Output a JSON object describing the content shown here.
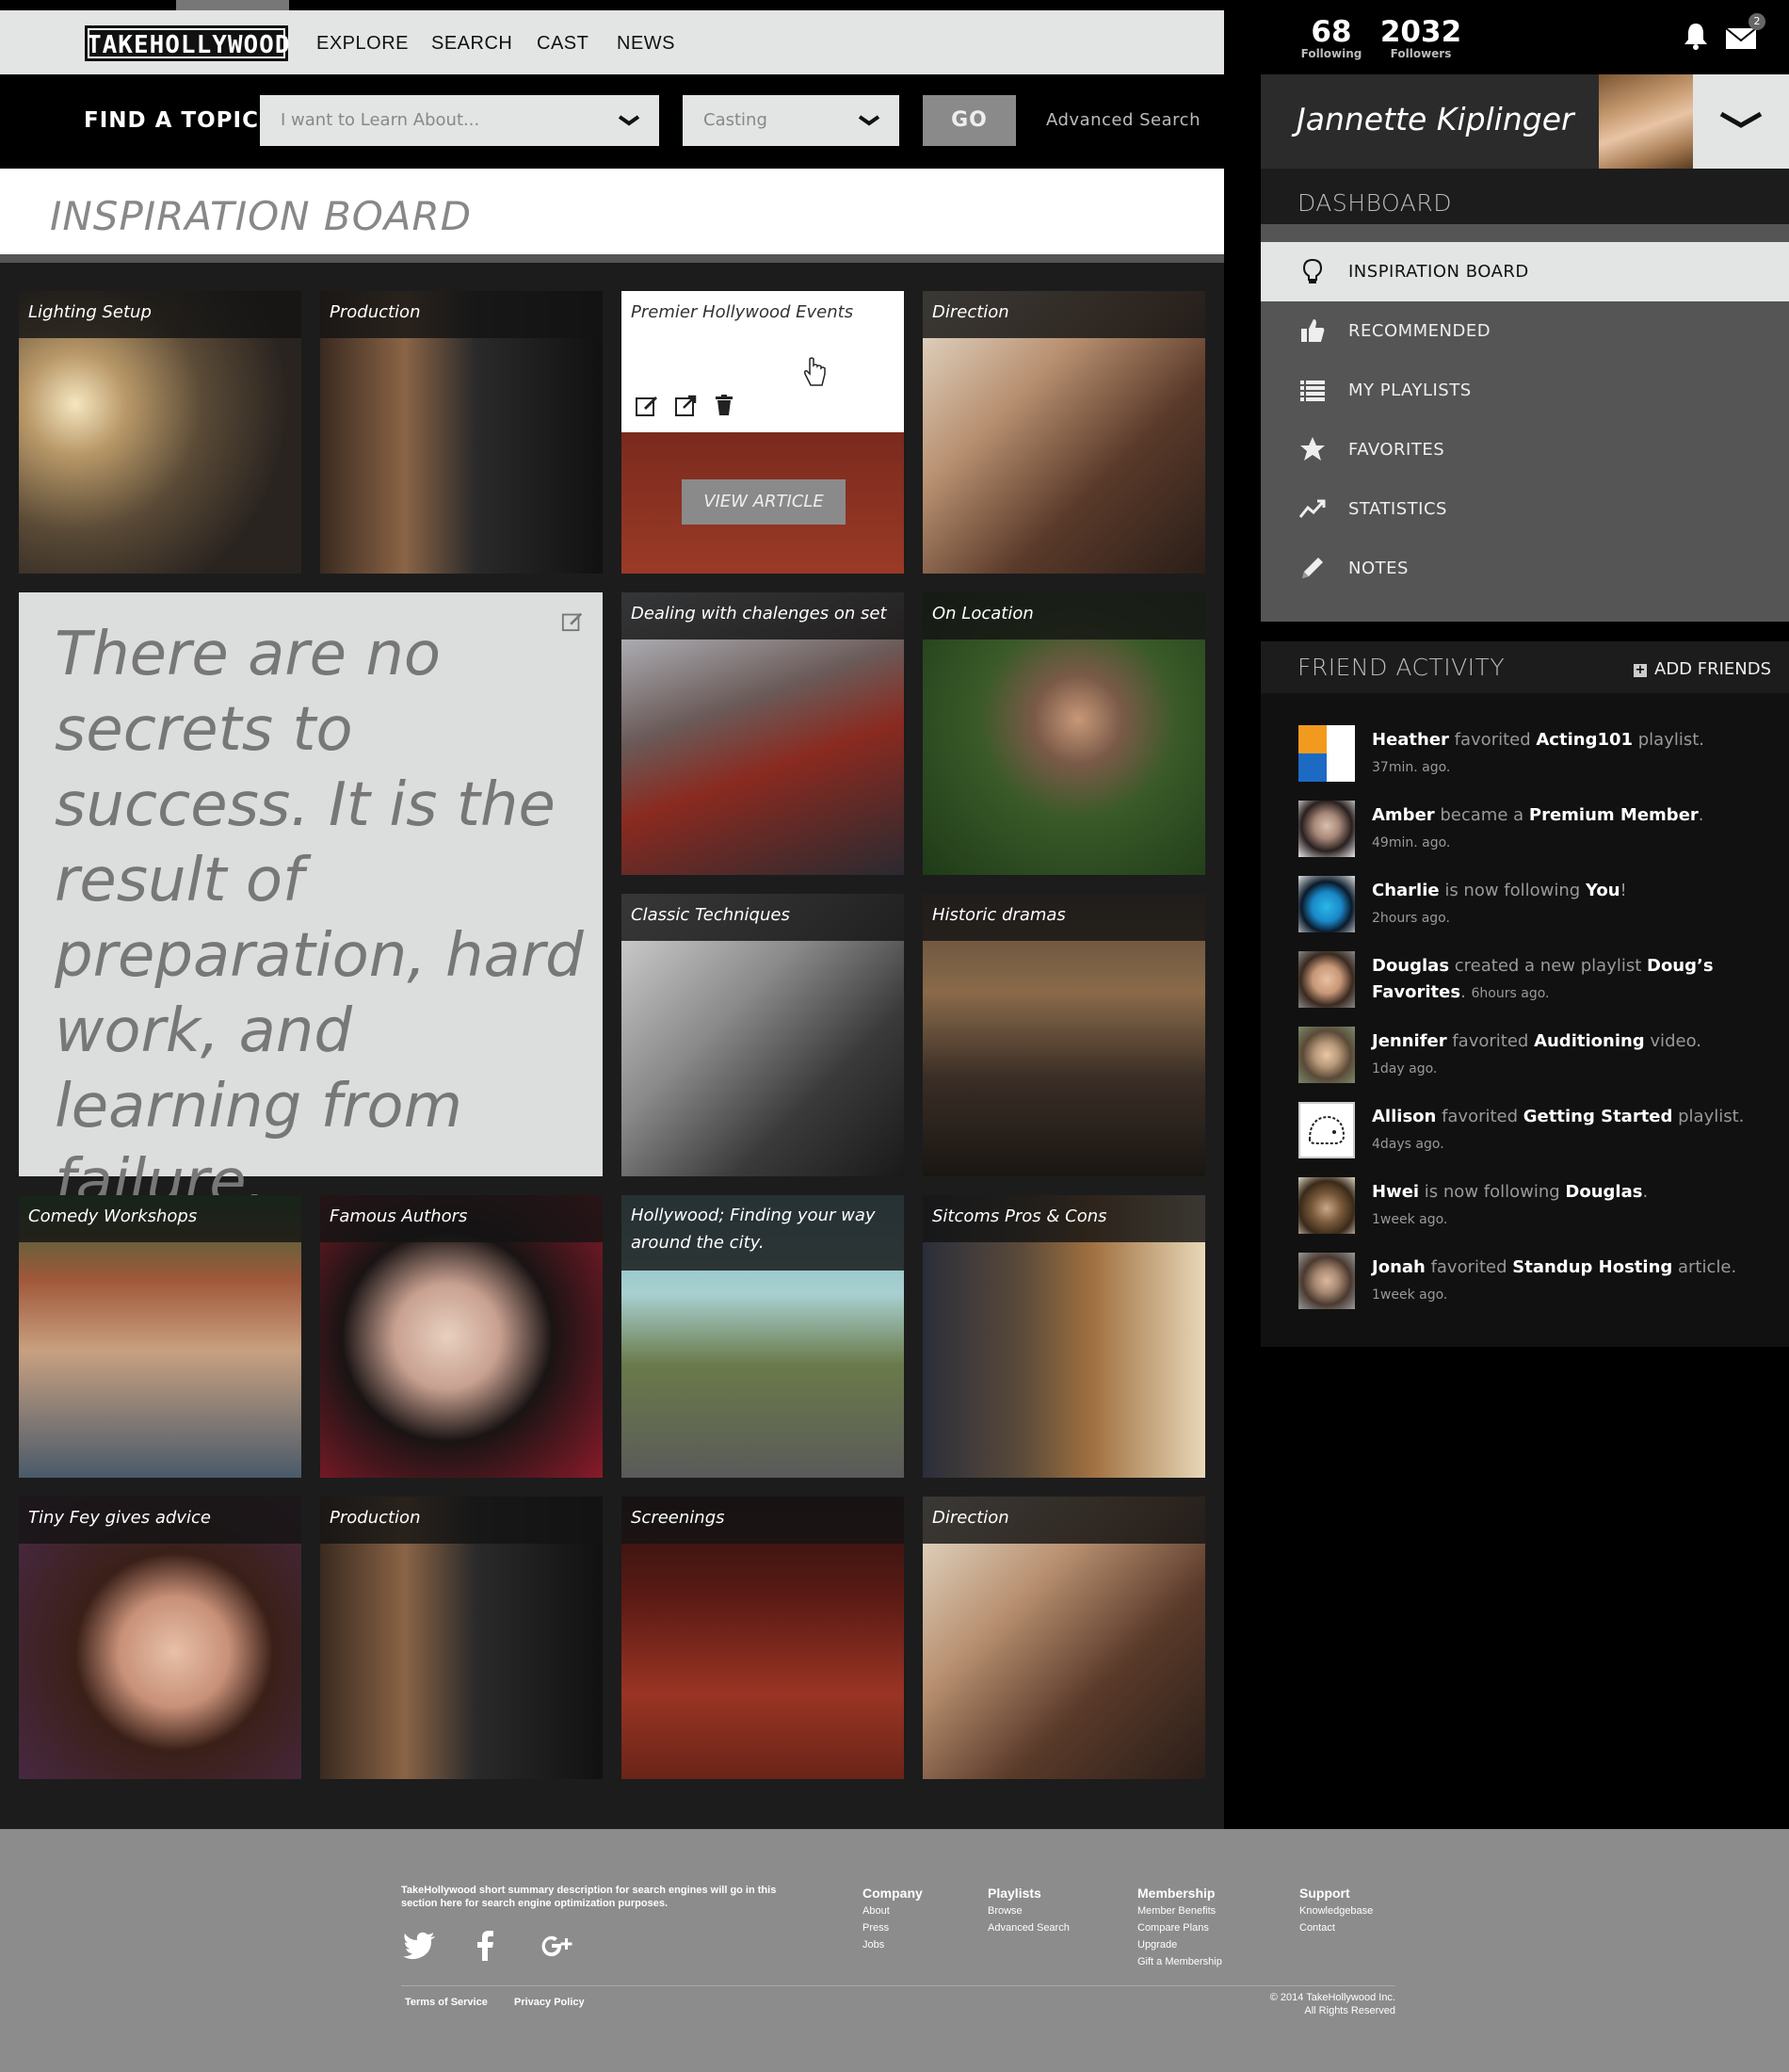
{
  "nav": {
    "logo": "TAKEHOLLYWOOD",
    "links": [
      "EXPLORE",
      "SEARCH",
      "CAST",
      "NEWS"
    ]
  },
  "find": {
    "label": "FIND A TOPIC",
    "topic_placeholder": "I want to Learn About...",
    "category_value": "Casting",
    "go": "GO",
    "advanced": "Advanced Search"
  },
  "page": {
    "title": "INSPIRATION BOARD"
  },
  "board": {
    "tiles": [
      "Lighting Setup",
      "Production",
      "Premier Hollywood Events",
      "Direction",
      "Dealing with chalenges on set",
      "On Location",
      "Classic Techniques",
      "Historic dramas",
      "Comedy Workshops",
      "Famous Authors",
      "Hollywood; Finding your way around the city.",
      "Sitcoms Pros & Cons",
      "Tiny Fey gives advice",
      "Production",
      "Screenings",
      "Direction"
    ],
    "view_article": "VIEW ARTICLE",
    "quote": "There are no secrets to success. It is the result of preparation, hard work, and learning from failure."
  },
  "user": {
    "following_count": "68",
    "following_label": "Following",
    "followers_count": "2032",
    "followers_label": "Followers",
    "mail_badge": "2",
    "name": "Jannette Kiplinger"
  },
  "dashboard": {
    "title": "DASHBOARD",
    "items": [
      "INSPIRATION BOARD",
      "RECOMMENDED",
      "MY PLAYLISTS",
      "FAVORITES",
      "STATISTICS",
      "NOTES"
    ]
  },
  "friends": {
    "title": "FRIEND ACTIVITY",
    "add": "ADD FRIENDS",
    "activity": [
      {
        "name": "Heather",
        "verb": " favorited ",
        "obj": "Acting101",
        "tail": " playlist.",
        "time": "37min. ago."
      },
      {
        "name": "Amber",
        "verb": " became a ",
        "obj": "Premium Member",
        "tail": ".",
        "time": "49min. ago."
      },
      {
        "name": "Charlie",
        "verb": " is now following ",
        "obj": "You",
        "tail": "!",
        "time": "2hours ago."
      },
      {
        "name": "Douglas",
        "verb": " created a new playlist ",
        "obj": "Doug’s Favorites",
        "tail": ". ",
        "time": "6hours ago."
      },
      {
        "name": "Jennifer",
        "verb": " favorited ",
        "obj": "Auditioning",
        "tail": " video.",
        "time": "1day ago."
      },
      {
        "name": "Allison",
        "verb": " favorited ",
        "obj": "Getting Started",
        "tail": " playlist.",
        "time": "4days ago."
      },
      {
        "name": "Hwei",
        "verb": " is now following ",
        "obj": "Douglas",
        "tail": ".",
        "time": "1week ago."
      },
      {
        "name": "Jonah",
        "verb": " favorited ",
        "obj": "Standup Hosting",
        "tail": " article.",
        "time": "1week ago."
      }
    ]
  },
  "footer": {
    "description": "TakeHollywood short summary description for  search engines will go in this section here for search engine optimization purposes.",
    "columns": [
      {
        "heading": "Company",
        "links": [
          "About",
          "Press",
          "Jobs"
        ]
      },
      {
        "heading": "Playlists",
        "links": [
          "Browse",
          "Advanced Search"
        ]
      },
      {
        "heading": "Membership",
        "links": [
          "Member Benefits",
          "Compare Plans",
          "Upgrade",
          "Gift a Membership"
        ]
      },
      {
        "heading": "Support",
        "links": [
          "Knowledgebase",
          "Contact"
        ]
      }
    ],
    "terms": "Terms of Service",
    "privacy": "Privacy Policy",
    "copyright": "© 2014 TakeHollywood Inc.",
    "rights": "All Rights Reserved"
  },
  "colors": {
    "accent_light": "#e3e5e4",
    "sidebar_active": "#e3e5e4",
    "button_gray": "#8a8a8a"
  }
}
